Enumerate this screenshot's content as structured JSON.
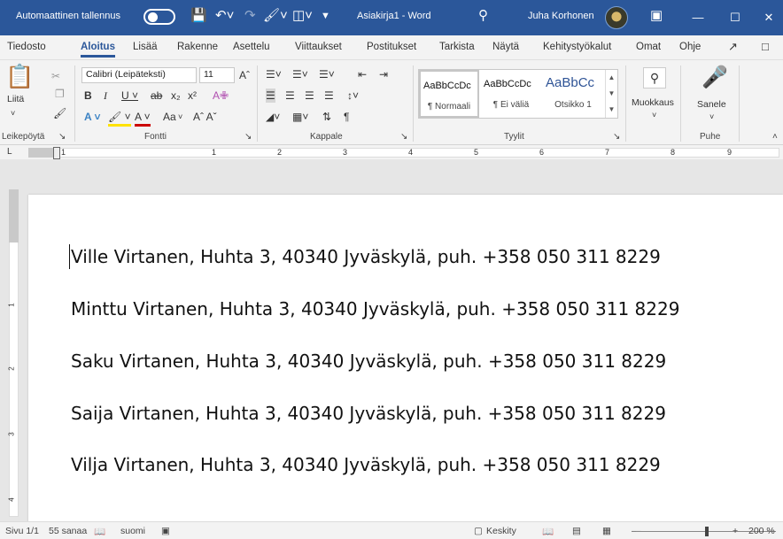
{
  "titlebar": {
    "autosave_label": "Automaattinen tallennus",
    "doc_title": "Asiakirja1  -  Word",
    "user_name": "Juha Korhonen"
  },
  "menu": {
    "tabs": [
      "Tiedosto",
      "Aloitus",
      "Lisää",
      "Rakenne",
      "Asettelu",
      "Viittaukset",
      "Postitukset",
      "Tarkista",
      "Näytä",
      "Kehitystyökalut",
      "Omat",
      "Ohje"
    ],
    "active": "Aloitus"
  },
  "ribbon": {
    "clipboard": {
      "paste_label": "Liitä",
      "group": "Leikepöytä"
    },
    "font": {
      "name": "Calibri (Leipäteksti)",
      "size": "11",
      "case_label": "Aa",
      "group": "Fontti"
    },
    "paragraph": {
      "group": "Kappale"
    },
    "styles": {
      "items": [
        {
          "preview": "AaBbCcDc",
          "name": "¶ Normaali"
        },
        {
          "preview": "AaBbCcDc",
          "name": "¶ Ei väliä"
        },
        {
          "preview": "AaBbCc",
          "name": "Otsikko 1"
        }
      ],
      "group": "Tyylit"
    },
    "editing": {
      "label": "Muokkaus"
    },
    "voice": {
      "label": "Sanele",
      "group": "Puhe"
    }
  },
  "ruler": {
    "numbers": [
      "1",
      "1",
      "2",
      "3",
      "4",
      "5",
      "6",
      "7",
      "8",
      "9"
    ]
  },
  "vruler": {
    "numbers": [
      "1",
      "2",
      "3",
      "4"
    ]
  },
  "document": {
    "lines": [
      "Ville Virtanen, Huhta 3, 40340 Jyväskylä, puh. +358 050 311 8229",
      "Minttu Virtanen, Huhta 3, 40340 Jyväskylä, puh. +358 050 311 8229",
      "Saku Virtanen, Huhta 3, 40340 Jyväskylä, puh. +358 050 311 8229",
      "Saija Virtanen, Huhta 3, 40340 Jyväskylä, puh. +358 050 311 8229",
      "Vilja Virtanen, Huhta 3, 40340 Jyväskylä, puh. +358 050 311 8229"
    ]
  },
  "status": {
    "page": "Sivu 1/1",
    "words": "55 sanaa",
    "language": "suomi",
    "focus": "Keskity",
    "zoom": "200 %",
    "zoom_level_percent": 200
  },
  "colors": {
    "accent": "#2b579a",
    "ribbon_bg": "#f3f3f3",
    "page_bg": "#ffffff",
    "canvas_bg": "#e6e6e6"
  }
}
